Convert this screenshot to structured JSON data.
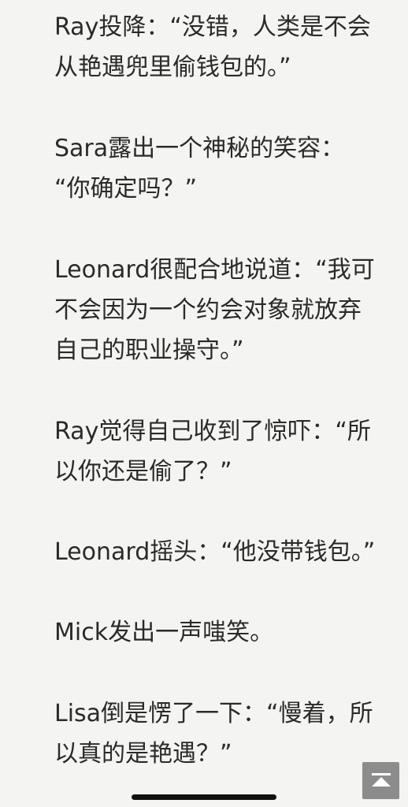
{
  "paragraphs": [
    {
      "lines": [
        "Ray投降：“没错，人类是不会",
        "从艳遇兜里偷钱包的。”"
      ]
    },
    {
      "lines": [
        "Sara露出一个神秘的笑容：",
        "“你确定吗？”"
      ]
    },
    {
      "lines": [
        "Leonard很配合地说道：“我可",
        "不会因为一个约会对象就放弃",
        "自己的职业操守。”"
      ]
    },
    {
      "lines": [
        "Ray觉得自己收到了惊吓：“所",
        "以你还是偷了？”"
      ]
    },
    {
      "lines": [
        "Leonard摇头：“他没带钱包。”"
      ]
    },
    {
      "lines": [
        "Mick发出一声嗤笑。"
      ]
    },
    {
      "lines": [
        "Lisa倒是愣了一下：“慢着，所",
        "以真的是艳遇？”"
      ]
    }
  ],
  "controls": {
    "scroll_top_icon": "arrow-up-to-top-icon",
    "scroll_top_color": "#8c8c8c"
  },
  "system": {
    "home_indicator_color": "#111111"
  }
}
